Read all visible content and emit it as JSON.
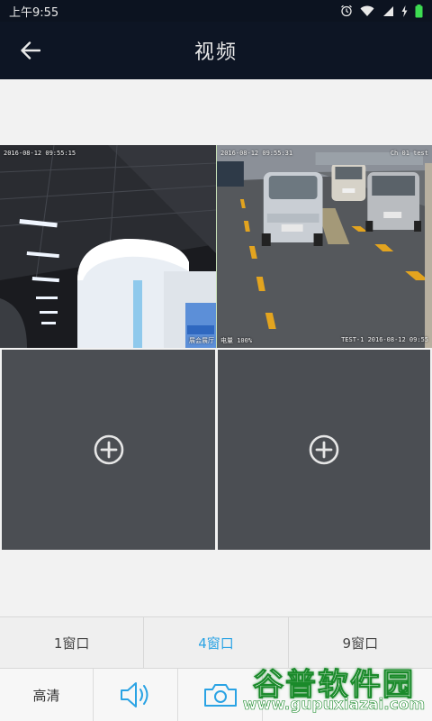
{
  "status_bar": {
    "time": "上午9:55"
  },
  "header": {
    "title": "视频"
  },
  "video_grid": {
    "cells": [
      {
        "state": "live",
        "overlay_top": "2016-08-12 09:55:15",
        "overlay_bottom": "展会展厅"
      },
      {
        "state": "live",
        "overlay_top": "2016-08-12 09:55:31",
        "overlay_top_right": "Ch 01 test",
        "overlay_bottom_left": "电量 100%",
        "overlay_bottom_right": "TEST-1 2016-08-12 09:55"
      },
      {
        "state": "empty"
      },
      {
        "state": "empty"
      }
    ]
  },
  "window_tabs": [
    {
      "label": "1窗口",
      "active": false
    },
    {
      "label": "4窗口",
      "active": true
    },
    {
      "label": "9窗口",
      "active": false
    }
  ],
  "toolbar": {
    "quality_label": "高清",
    "icons": [
      "speaker-icon",
      "camera-icon"
    ]
  },
  "watermark": {
    "text": "谷普软件园",
    "url": "www.gupuxiazai.com"
  },
  "colors": {
    "accent": "#2aa3e4",
    "header_bg": "#0d1524",
    "empty_cell": "#4b4e53"
  }
}
